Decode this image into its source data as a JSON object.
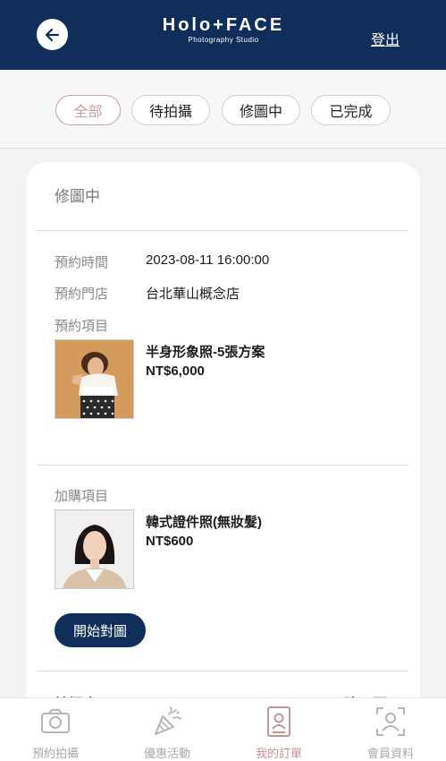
{
  "header": {
    "logo_main": "Holo+FACE",
    "logo_sub": "Photography Studio",
    "logout_label": "登出"
  },
  "filters": [
    {
      "label": "全部",
      "active": true
    },
    {
      "label": "待拍攝",
      "active": false
    },
    {
      "label": "修圖中",
      "active": false
    },
    {
      "label": "已完成",
      "active": false
    }
  ],
  "order": {
    "status": "修圖中",
    "booking_time_label": "預約時間",
    "booking_time": "2023-08-11 16:00:00",
    "store_label": "預約門店",
    "store": "台北華山概念店",
    "item_label": "預約項目",
    "item": {
      "name": "半身形象照-5張方案",
      "price": "NT$6,000"
    },
    "addon_label": "加購項目",
    "addon": {
      "name": "韓式證件照(無妝髮)",
      "price": "NT$600"
    },
    "action_label": "開始對圖",
    "next_left": "拍攝人",
    "next_right": "陸冠顥"
  },
  "nav": [
    {
      "label": "預約拍攝",
      "icon": "camera-icon",
      "active": false
    },
    {
      "label": "優惠活動",
      "icon": "party-popper-icon",
      "active": false
    },
    {
      "label": "我的訂單",
      "icon": "order-card-icon",
      "active": true
    },
    {
      "label": "會員資料",
      "icon": "member-profile-icon",
      "active": false
    }
  ],
  "colors": {
    "header_bg": "#0f2f5a",
    "accent_pink": "#c39596",
    "button_bg": "#0f2f5a"
  }
}
